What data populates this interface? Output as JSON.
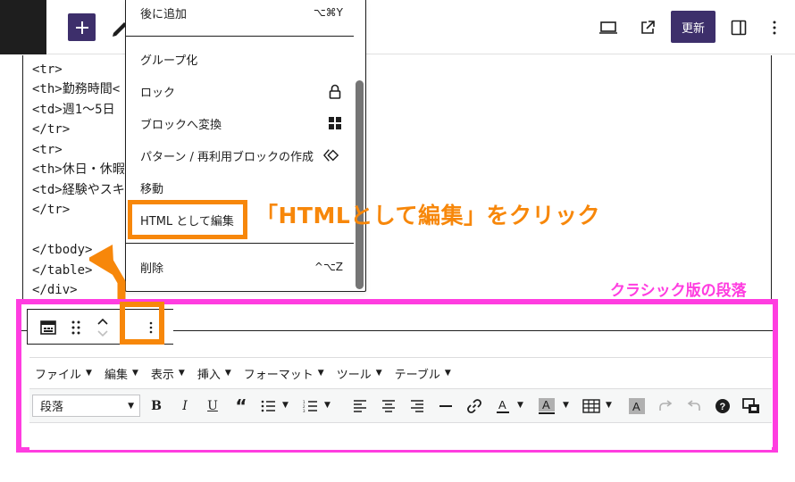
{
  "topbar": {
    "update_label": "更新",
    "icons": [
      "wordpress-logo",
      "plus-icon",
      "pen-icon",
      "laptop-icon",
      "external-link-icon",
      "sidebar-icon",
      "more-vertical-icon"
    ]
  },
  "code_lines": [
    "<tr>",
    "<th>勤務時間<",
    "<td>週1〜5日",
    "</tr>",
    "<tr>",
    "<th>休日・休暇",
    "<td>経験やスキ",
    "</tr>",
    "",
    "</tbody>",
    "</table>",
    "</div>"
  ],
  "menu": {
    "items": [
      {
        "label": "後に追加",
        "shortcut": "⌥⌘Y"
      },
      {
        "label": "グループ化"
      },
      {
        "label": "ロック",
        "icon": "lock-icon"
      },
      {
        "label": "ブロックへ変換",
        "icon": "grid-icon"
      },
      {
        "label": "パターン / 再利用ブロックの作成",
        "icon": "symbol-icon"
      },
      {
        "label": "移動"
      },
      {
        "label": "HTML として編集"
      },
      {
        "label": "削除",
        "shortcut": "^⌥Z"
      }
    ]
  },
  "annotations": {
    "callout": "「HTMLとして編集」をクリック",
    "classic_label": "クラシック版の段落",
    "accent_orange": "#f7870a",
    "accent_pink": "#ff3de0"
  },
  "classic": {
    "menubar": [
      "ファイル",
      "編集",
      "表示",
      "挿入",
      "フォーマット",
      "ツール",
      "テーブル"
    ],
    "format_value": "段落",
    "toolbar_icons": [
      "bold-icon",
      "italic-icon",
      "underline-icon",
      "blockquote-icon",
      "bullet-list-icon",
      "numbered-list-icon",
      "align-left-icon",
      "align-center-icon",
      "align-right-icon",
      "horizontal-line-icon",
      "link-icon",
      "text-color-icon",
      "background-color-icon",
      "table-icon",
      "clear-formatting-icon",
      "redo-icon",
      "undo-icon",
      "help-icon",
      "toolbar-toggle-icon"
    ]
  }
}
